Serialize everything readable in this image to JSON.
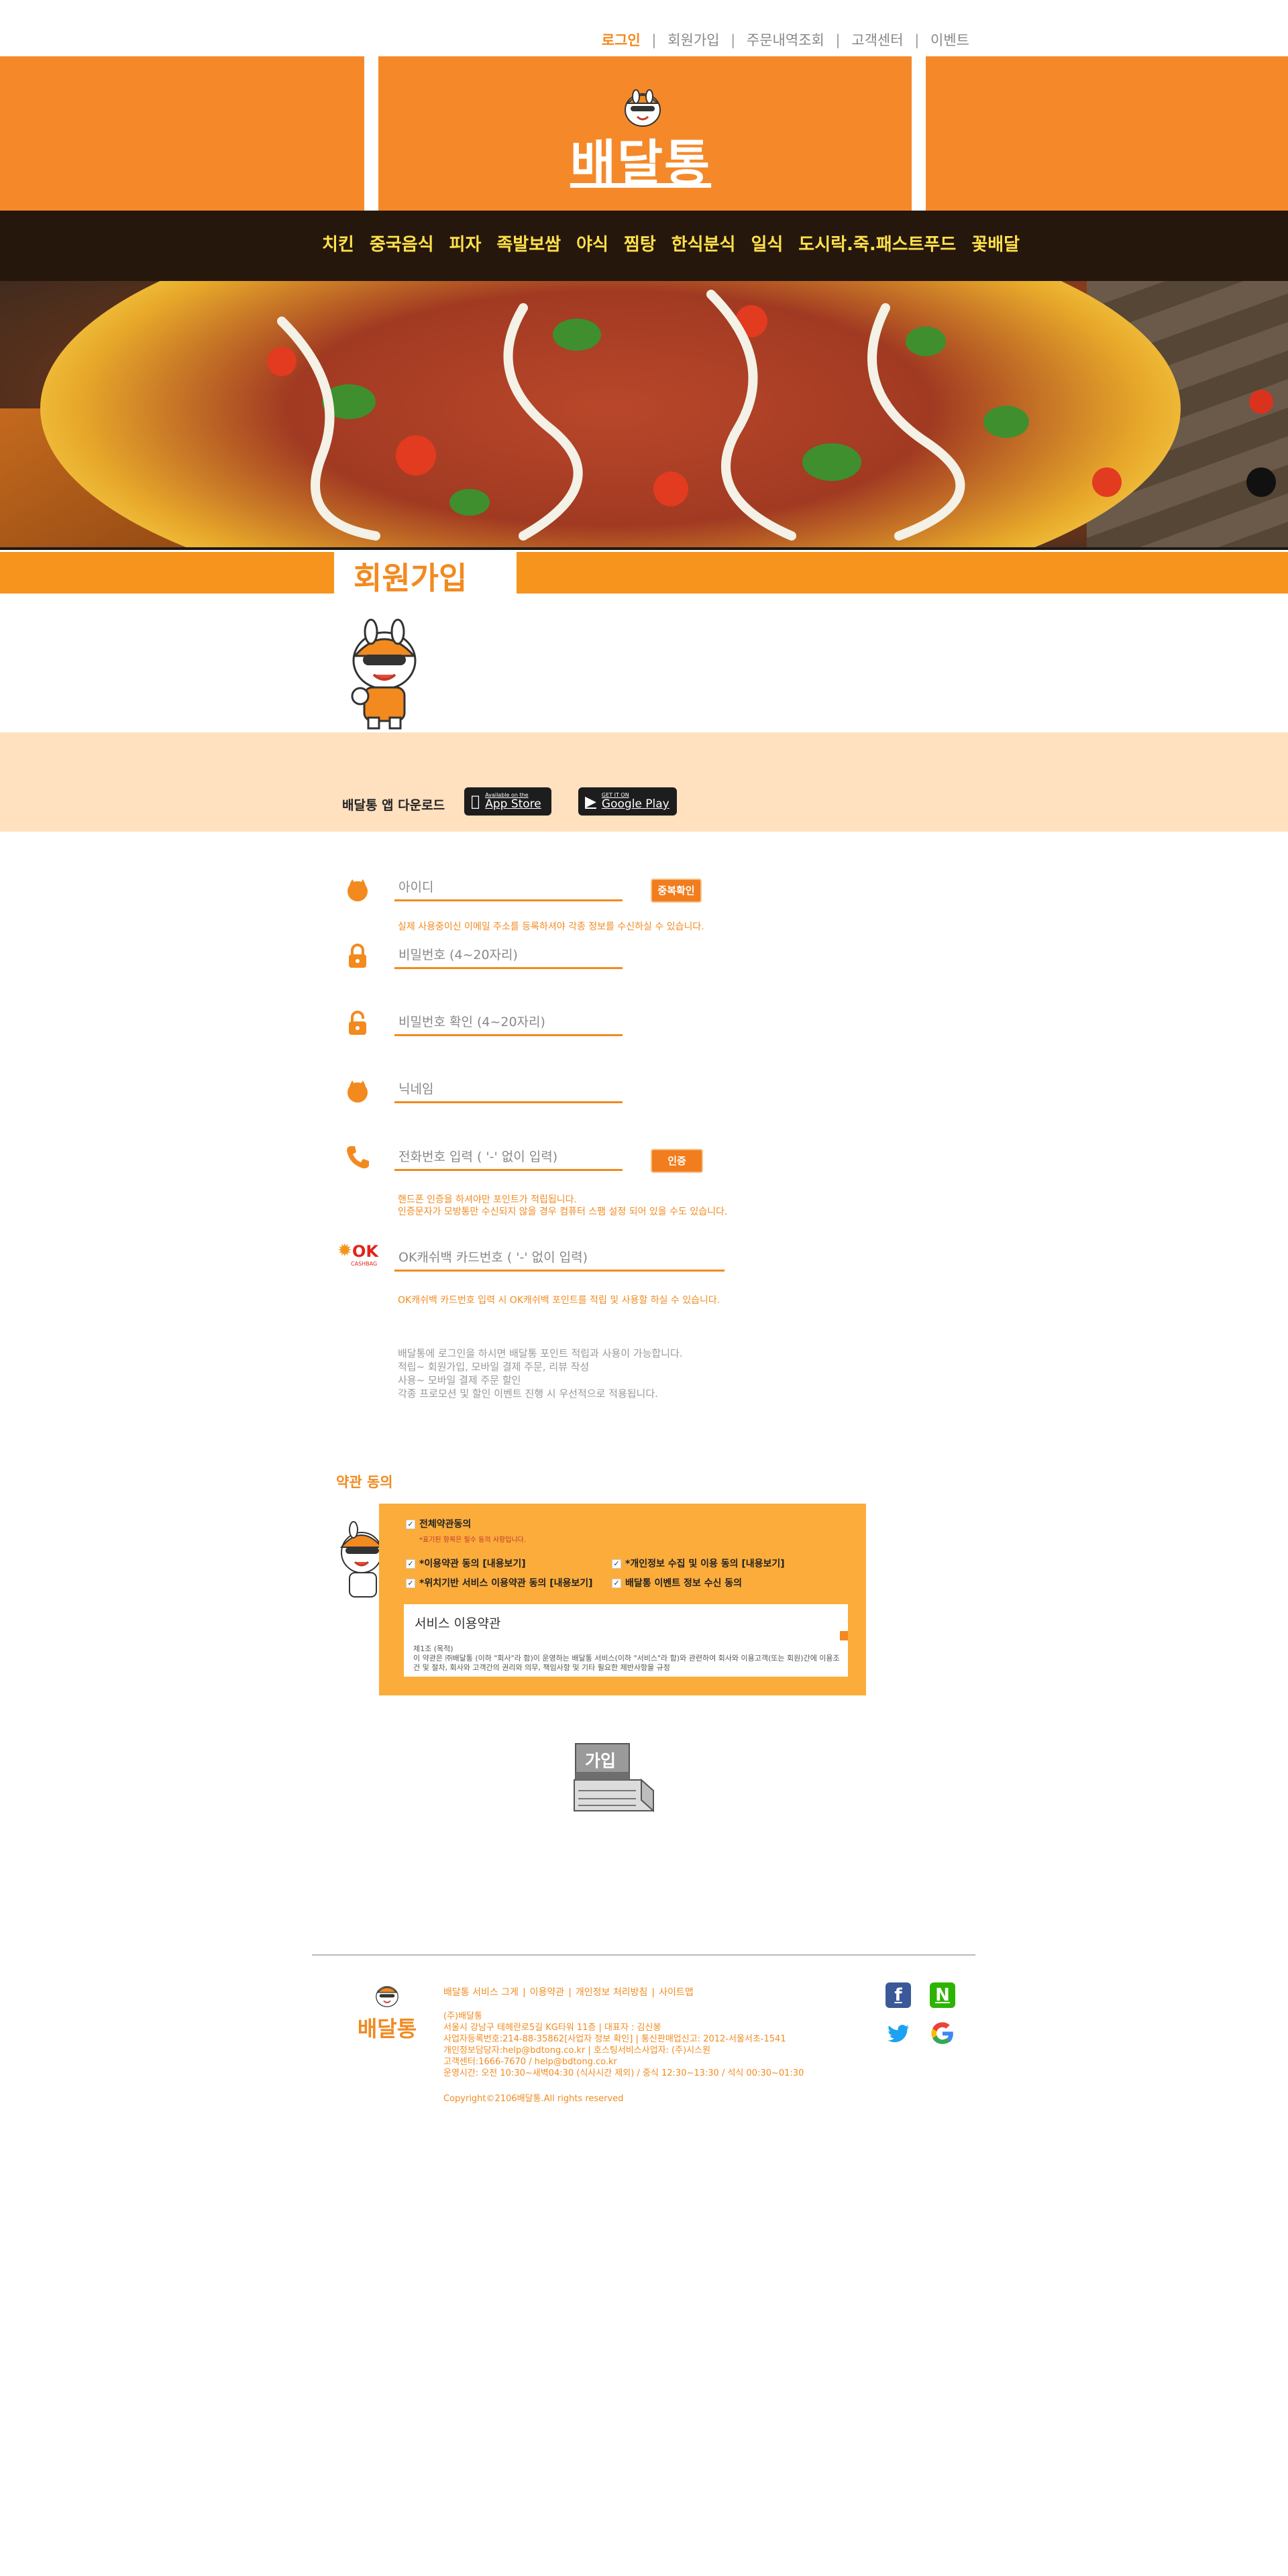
{
  "top_links": {
    "login": "로그인",
    "signup": "회원가입",
    "order_history": "주문내역조회",
    "customer_center": "고객센터",
    "event": "이벤트",
    "separator": "|"
  },
  "header": {
    "logo_text": "배달통"
  },
  "nav": {
    "items": [
      "치킨",
      "중국음식",
      "피자",
      "족발보쌈",
      "야식",
      "찜탕",
      "한식분식",
      "일식",
      "도시락.죽.패스트푸드",
      "꽃배달"
    ]
  },
  "page": {
    "title": "회원가입"
  },
  "app_download": {
    "label": "배달통 앱 다운로드",
    "appstore_small": "Available on the",
    "appstore_big": "App Store",
    "gplay_small": "GET IT ON",
    "gplay_big": "Google Play"
  },
  "form": {
    "id_placeholder": "아이디",
    "dup_check_label": "중복확인",
    "email_hint": "실제 사용중이신 이메일 주소를 등록하셔야 각종 정보를 수신하실 수 있습니다.",
    "pw_placeholder": "비밀번호 (4~20자리)",
    "pw_confirm_placeholder": "비밀번호 확인 (4~20자리)",
    "nickname_placeholder": "닉네임",
    "phone_placeholder": "전화번호 입력 ( '-' 없이 입력)",
    "verify_label": "인증",
    "phone_hint_1": "핸드폰 인증을 하셔야만 포인트가 적립됩니다.",
    "phone_hint_2": "인증문자가 모방통만 수신되지 않을 경우 컴퓨터 스팸 설정 되어 있을 수도 있습니다.",
    "ok_logo": "OK",
    "ok_logo_sub": "CASHBAG",
    "ok_placeholder": "OK캐쉬백 카드번호 ( '-' 없이 입력)",
    "ok_hint": "OK캐쉬백 카드번호 입력 시 OK캐쉬백 포인트를 적립 및 사용할 하실 수 있습니다.",
    "info_lines": [
      "배달통에 로그인을 하시면 배달통 포인트 적립과 사용이 가능합니다.",
      "적립~ 회원가입, 모바일 결제 주문, 리뷰 작성",
      "사용~ 모바일 결제 주문 할인",
      "각종 프로모션 및 할인 이벤트 진행 시 우선적으로 적용됩니다."
    ]
  },
  "terms": {
    "title": "약관 동의",
    "agree_all": "전체약관동의",
    "agree_all_sub": "*표기된 항목은 필수 동의 사항입니다.",
    "items": [
      "*이용약관 동의 [내용보기]",
      "*개인정보 수집 및 이용 동의 [내용보기]",
      "*위치기반 서비스 이용약관 동의 [내용보기]",
      "배달통 이벤트 정보 수신 동의"
    ],
    "tos_title": "서비스 이용약관",
    "tos_article": "제1조 (목적)",
    "tos_body": "이 약관은 ㈜배달통 (이하 \"회사\"라 함)이 운영하는 배달통 서비스(이하 \"서비스\"라 함)와 관련하여 회사와 이용고객(또는 회원)간에 이용조건 및 절차, 회사와 고객간의 권리와 의무, 책임사항 및 기타 필요한 제반사항을 규정"
  },
  "join_button": {
    "label": "가입"
  },
  "footer": {
    "logo_text": "배달통",
    "links": [
      "배달통 서비스 그게",
      "이용약관",
      "개인정보 처리방침",
      "사이트맵"
    ],
    "info_lines": [
      "(주)배달통",
      "서울시 강남구 테헤란로5길 KG타워 11층 | 대표자 : 김신봉",
      "사업자등록번호:214-88-35862[사업자 정보 확인] | 통신판매업신고: 2012-서울서초-1541",
      "개인정보담당자:help@bdtong.co.kr | 호스팅서비스사업자: (주)시스원",
      "고객센터:1666-7670 / help@bdtong.co.kr",
      "운영시간: 오전 10:30~새벽04:30 (식사시간 제외) / 중식 12:30~13:30 / 석식 00:30~01:30"
    ],
    "copyright": "Copyright©2106배달통.All rights reserved"
  },
  "colors": {
    "brand_orange": "#f5892a",
    "nav_bg": "#26170c",
    "nav_text": "#ffe14a",
    "app_band": "#ffe0bf",
    "terms_box": "#fbac3b"
  }
}
